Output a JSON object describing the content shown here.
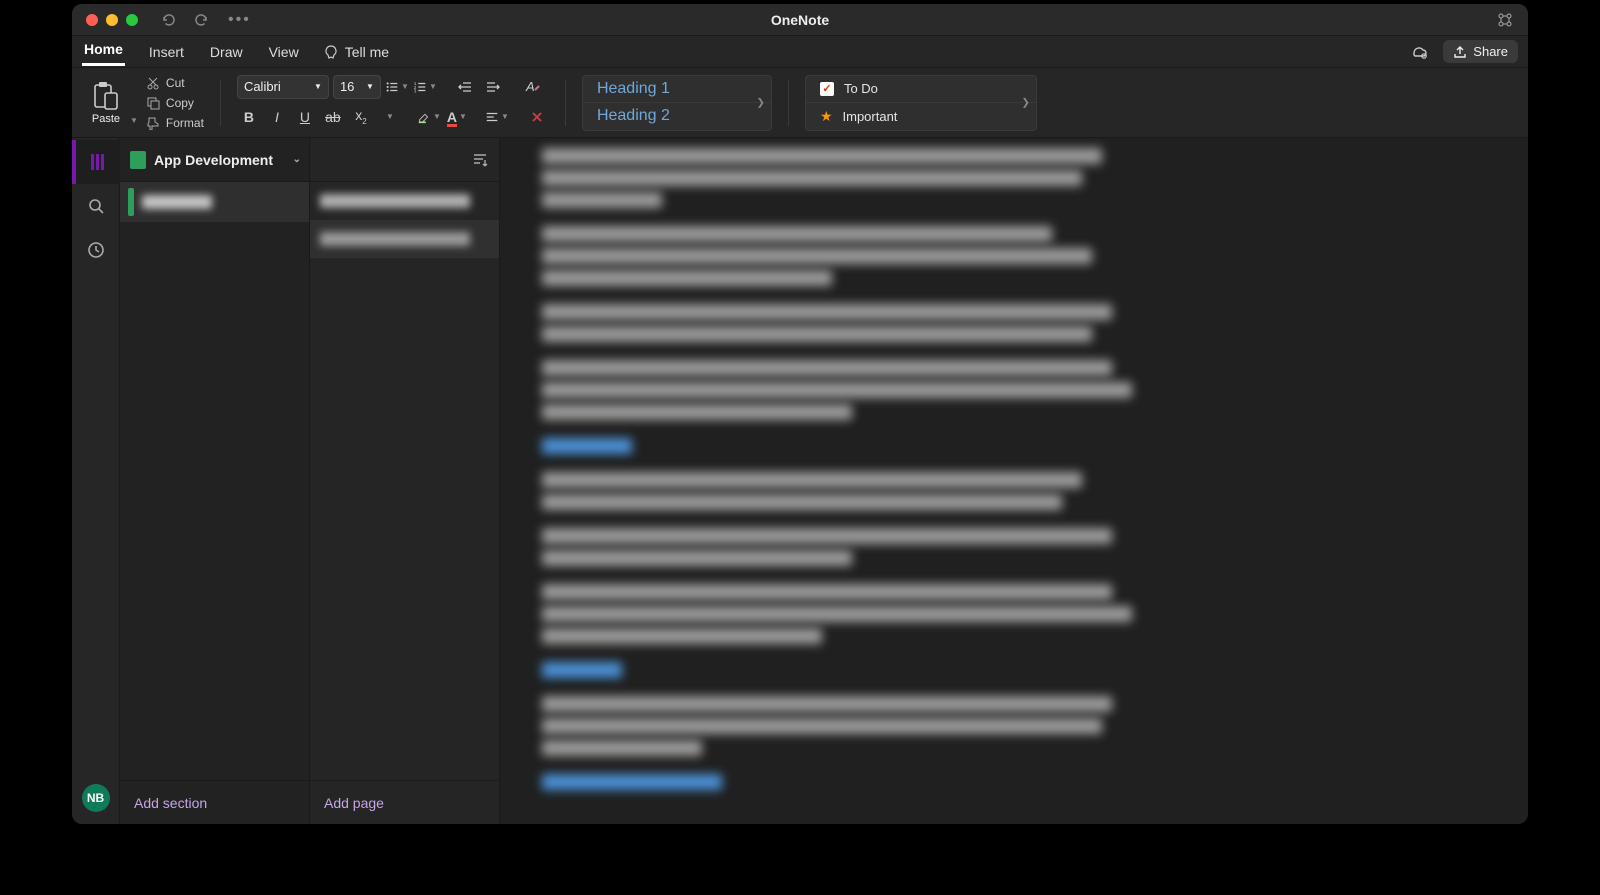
{
  "title": "OneNote",
  "menu": {
    "tabs": [
      "Home",
      "Insert",
      "Draw",
      "View"
    ],
    "active": "Home",
    "tellme": "Tell me",
    "share": "Share"
  },
  "ribbon": {
    "paste": "Paste",
    "cut": "Cut",
    "copy": "Copy",
    "format": "Format",
    "font_name": "Calibri",
    "font_size": "16",
    "styles": {
      "h1": "Heading 1",
      "h2": "Heading 2"
    },
    "tags": {
      "todo": "To Do",
      "important": "Important"
    }
  },
  "notebook": {
    "name": "App Development",
    "sections": [
      {
        "color": "#2e9e5b"
      }
    ],
    "pages": [
      {
        "selected": false
      },
      {
        "selected": true
      }
    ],
    "add_section": "Add section",
    "add_page": "Add page"
  },
  "user": {
    "initials": "NB"
  },
  "colors": {
    "purple": "#7719aa",
    "link": "#4a8fd4",
    "section_green": "#2e9e5b"
  }
}
